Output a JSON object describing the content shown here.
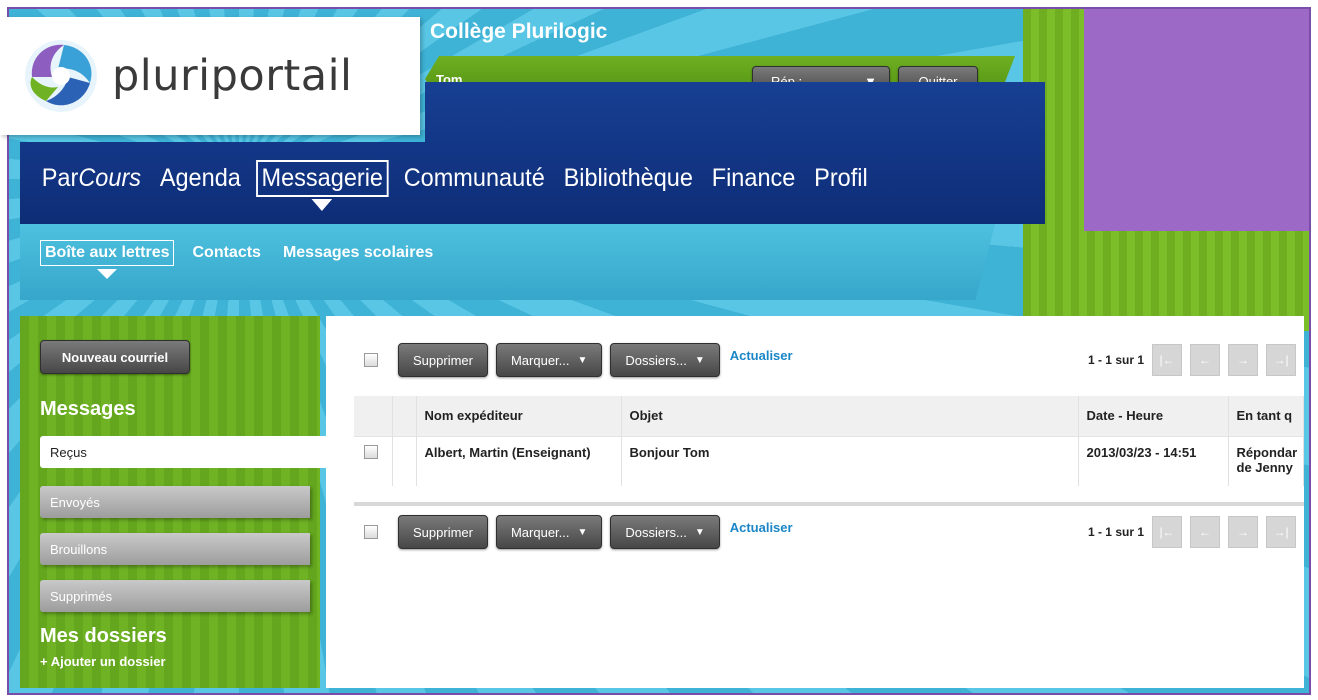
{
  "header": {
    "logo_text": "pluriportail",
    "school_name": "Collège Plurilogic",
    "user_name": "Tom",
    "rep_select_label": "Rép.:",
    "quit_label": "Quitter"
  },
  "main_nav": {
    "items": [
      {
        "prefix": "Par",
        "italic": "Cours"
      },
      {
        "label": "Agenda"
      },
      {
        "label": "Messagerie"
      },
      {
        "label": "Communauté"
      },
      {
        "label": "Bibliothèque"
      },
      {
        "label": "Finance"
      },
      {
        "label": "Profil"
      }
    ],
    "active": "Messagerie"
  },
  "sub_nav": {
    "items": [
      "Boîte aux lettres",
      "Contacts",
      "Messages scolaires"
    ],
    "active": "Boîte aux lettres"
  },
  "sidebar": {
    "new_mail_label": "Nouveau courriel",
    "messages_heading": "Messages",
    "items": [
      "Reçus",
      "Envoyés",
      "Brouillons",
      "Supprimés"
    ],
    "active": "Reçus",
    "folders_heading": "Mes dossiers",
    "add_folder_label": "+ Ajouter un dossier"
  },
  "toolbar": {
    "delete_label": "Supprimer",
    "mark_label": "Marquer...",
    "folders_label": "Dossiers...",
    "refresh_label": "Actualiser",
    "page_info": "1 - 1 sur 1"
  },
  "table": {
    "columns": [
      "Nom expéditeur",
      "Objet",
      "Date - Heure",
      "En tant q"
    ],
    "rows": [
      {
        "sender": "Albert, Martin (Enseignant)",
        "subject": "Bonjour Tom",
        "datetime": "2013/03/23 - 14:51",
        "as_line1": "Répondar",
        "as_line2": "de Jenny"
      }
    ]
  },
  "colors": {
    "frame_border": "#7a4ea8",
    "accent_green": "#6eb021",
    "nav_blue": "#173f93",
    "sky_blue": "#4ec0df",
    "purple": "#9c6ac6",
    "link_blue": "#1a86c7"
  }
}
